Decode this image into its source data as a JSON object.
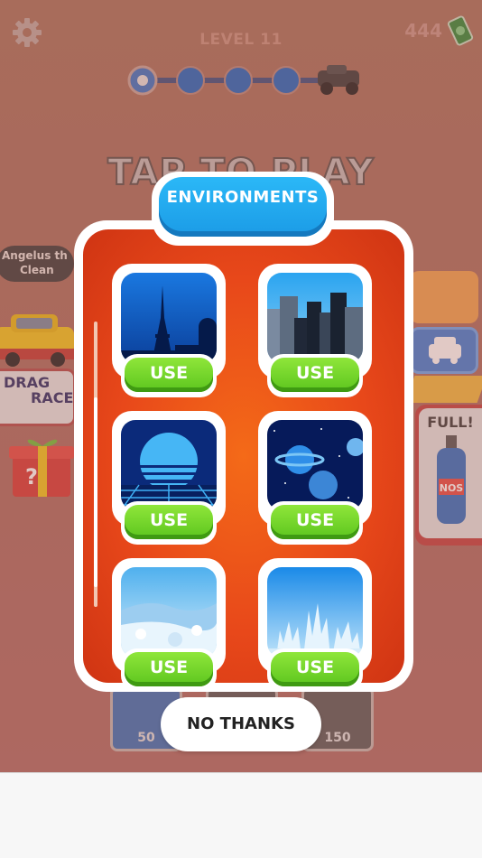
{
  "hud": {
    "level": "LEVEL 11",
    "money": "444",
    "tap_to_play": "TAP TO PLAY",
    "progress": {
      "completed_stages": 1,
      "total_stages": 4
    }
  },
  "background": {
    "left_pill_line1": "Angelus th",
    "left_pill_line2": "Clean",
    "drag_race_line1": "DRAG",
    "drag_race_line2": "RACE",
    "full_label": "FULL!",
    "nos_label": "NOS",
    "upgrade_prices": [
      "50",
      "150"
    ]
  },
  "dialog": {
    "title": "ENVIRONMENTS",
    "items": [
      {
        "name": "paris",
        "button": "USE"
      },
      {
        "name": "city",
        "button": "USE"
      },
      {
        "name": "synthwave",
        "button": "USE"
      },
      {
        "name": "space",
        "button": "USE"
      },
      {
        "name": "snow",
        "button": "USE"
      },
      {
        "name": "underwater",
        "button": "USE"
      }
    ],
    "dismiss_button": "NO THANKS"
  },
  "colors": {
    "panel_orange": "#e8481a",
    "title_blue": "#1b9be6",
    "use_green": "#5cc51e",
    "background": "#a8705c"
  }
}
